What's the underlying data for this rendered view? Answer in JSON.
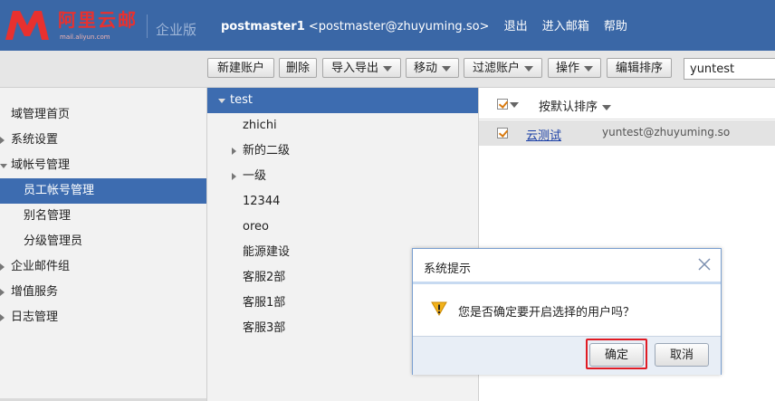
{
  "header": {
    "logo_text": "阿里云邮",
    "logo_sub": "mail.aliyun.com",
    "edition": "企业版",
    "username": "postmaster1",
    "email": "<postmaster@zhuyuming.so>",
    "links": [
      "退出",
      "进入邮箱",
      "帮助"
    ]
  },
  "toolbar": {
    "buttons": [
      "新建账户",
      "删除",
      "导入导出",
      "移动",
      "过滤账户",
      "操作",
      "编辑排序"
    ],
    "search_value": "yuntest"
  },
  "sidebar": {
    "items": [
      {
        "label": "域管理首页"
      },
      {
        "label": "系统设置"
      },
      {
        "label": "域帐号管理"
      },
      {
        "label": "员工帐号管理"
      },
      {
        "label": "别名管理"
      },
      {
        "label": "分级管理员"
      },
      {
        "label": "企业邮件组"
      },
      {
        "label": "增值服务"
      },
      {
        "label": "日志管理"
      }
    ]
  },
  "tree": {
    "items": [
      {
        "label": "test"
      },
      {
        "label": "zhichi"
      },
      {
        "label": "新的二级"
      },
      {
        "label": "一级"
      },
      {
        "label": "12344"
      },
      {
        "label": "oreo"
      },
      {
        "label": "能源建设"
      },
      {
        "label": "客服2部"
      },
      {
        "label": "客服1部"
      },
      {
        "label": "客服3部"
      }
    ]
  },
  "list": {
    "sort_label": "按默认排序",
    "rows": [
      {
        "name": "云测试",
        "email": "yuntest@zhuyuming.so"
      }
    ]
  },
  "dialog": {
    "title": "系统提示",
    "message": "您是否确定要开启选择的用户吗？",
    "ok": "确定",
    "cancel": "取消"
  },
  "colors": {
    "header_bg": "#3a67a6",
    "active_bg": "#3d6cb0",
    "logo_red": "#e8312f",
    "highlight_red": "#e01b24"
  }
}
